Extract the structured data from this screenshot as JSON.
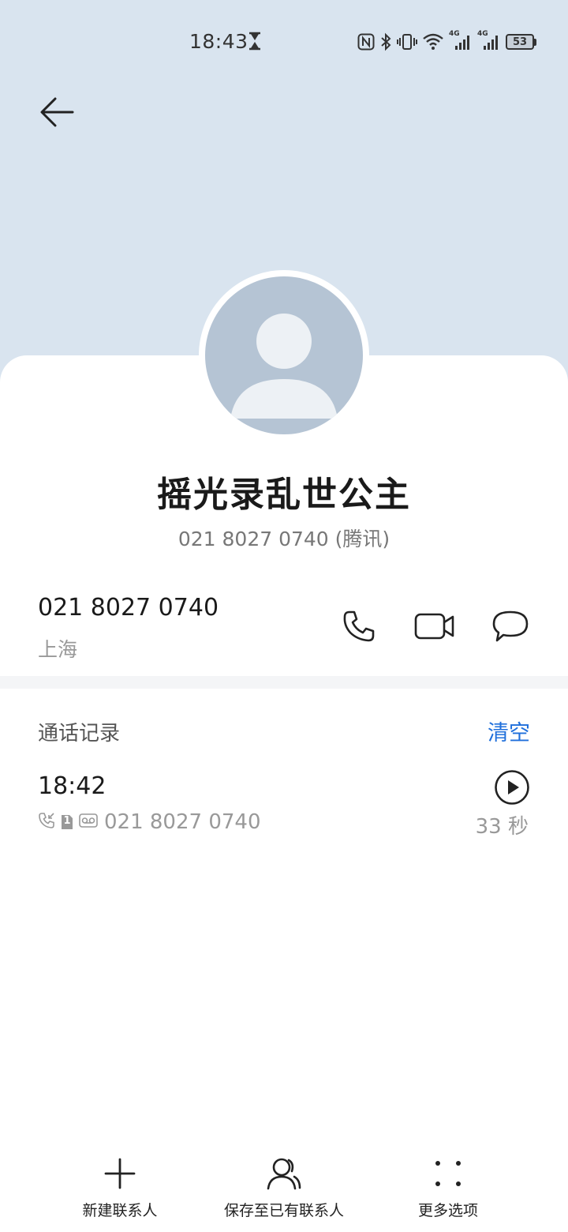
{
  "status_bar": {
    "time": "18:43",
    "battery": "53",
    "network_1": "4G",
    "network_2": "4G"
  },
  "contact": {
    "name": "摇光录乱世公主",
    "subtitle": "021 8027 0740 (腾讯)"
  },
  "phone": {
    "number": "021 8027 0740",
    "location": "上海"
  },
  "call_log": {
    "title": "通话记录",
    "clear_label": "清空",
    "entries": [
      {
        "time": "18:42",
        "number": "021 8027 0740",
        "sim": "1",
        "duration": "33 秒"
      }
    ]
  },
  "bottom_bar": {
    "new_contact": "新建联系人",
    "save_existing": "保存至已有联系人",
    "more_options": "更多选项"
  },
  "colors": {
    "header_bg": "#d9e4ef",
    "accent": "#1f6fdb",
    "avatar_bg": "#b5c4d4"
  }
}
